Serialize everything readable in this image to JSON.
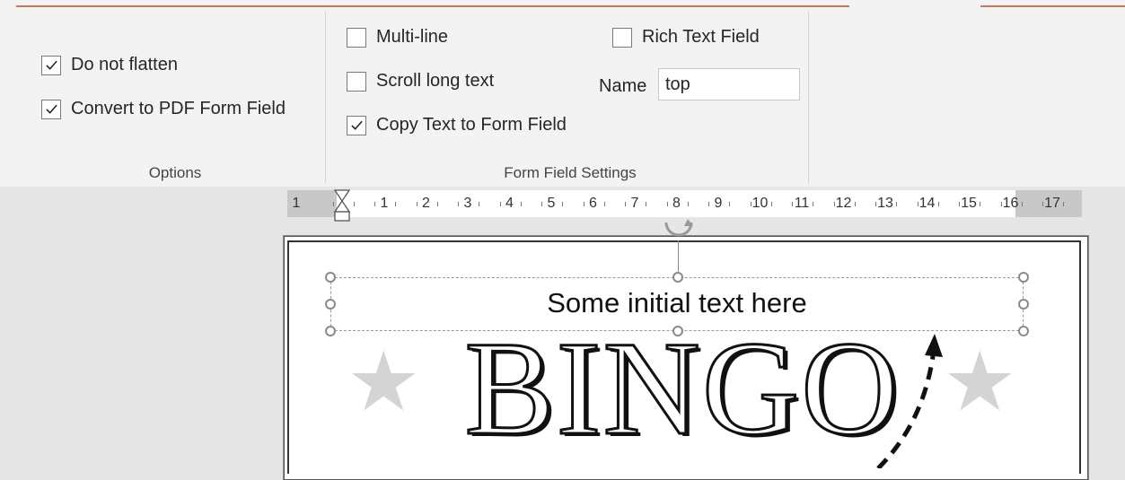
{
  "ribbon": {
    "options_group": {
      "label": "Options",
      "checkboxes": [
        {
          "label": "Do not flatten",
          "checked": true
        },
        {
          "label": "Convert to PDF Form Field",
          "checked": true
        }
      ]
    },
    "form_field_group": {
      "label": "Form Field Settings",
      "multi_line": {
        "label": "Multi-line",
        "checked": false
      },
      "scroll_long_text": {
        "label": "Scroll long text",
        "checked": false
      },
      "copy_text": {
        "label": "Copy Text to Form Field",
        "checked": true
      },
      "rich_text": {
        "label": "Rich Text Field",
        "checked": false
      },
      "name_label": "Name",
      "name_value": "top"
    }
  },
  "ruler": {
    "numbers": [
      "1",
      "1",
      "2",
      "3",
      "4",
      "5",
      "6",
      "7",
      "8",
      "9",
      "10",
      "11",
      "12",
      "13",
      "14",
      "15",
      "16",
      "17"
    ]
  },
  "slide": {
    "text_box": "Some initial text here",
    "title": "BINGO"
  }
}
